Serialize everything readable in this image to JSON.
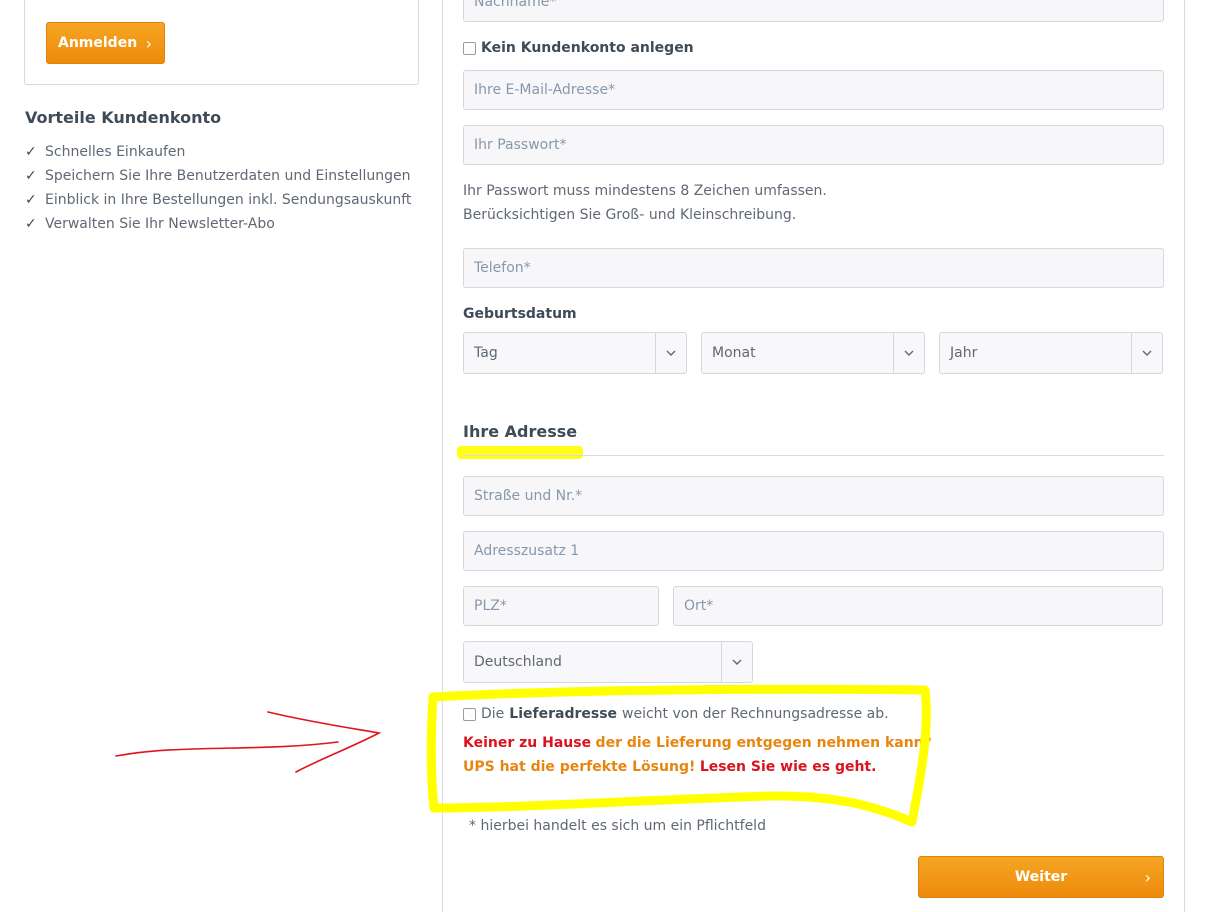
{
  "left": {
    "login_button": "Anmelden",
    "advantages_title": "Vorteile Kundenkonto",
    "advantages": [
      "Schnelles Einkaufen",
      "Speichern Sie Ihre Benutzerdaten und Einstellungen",
      "Einblick in Ihre Bestellungen inkl. Sendungsauskunft",
      "Verwalten Sie Ihr Newsletter-Abo"
    ]
  },
  "form": {
    "lastname_placeholder": "Nachname*",
    "no_account_label": "Kein Kundenkonto anlegen",
    "email_placeholder": "Ihre E-Mail-Adresse*",
    "password_placeholder": "Ihr Passwort*",
    "password_hint_1": "Ihr Passwort muss mindestens 8 Zeichen umfassen.",
    "password_hint_2": "Berücksichtigen Sie Groß- und Kleinschreibung.",
    "phone_placeholder": "Telefon*",
    "birthdate_label": "Geburtsdatum",
    "day_select": "Tag",
    "month_select": "Monat",
    "year_select": "Jahr"
  },
  "address": {
    "title": "Ihre Adresse",
    "street_placeholder": "Straße und Nr.*",
    "addition_placeholder": "Adresszusatz 1",
    "zip_placeholder": "PLZ*",
    "city_placeholder": "Ort*",
    "country_select": "Deutschland",
    "delivery_prefix": "Die",
    "delivery_bold": "Lieferadresse",
    "delivery_suffix": "weicht von der Rechnungsadresse ab.",
    "promo_red_1": "Keiner zu Hause",
    "promo_orange_1": "der die Lieferung entgegen nehmen kann?",
    "promo_orange_2": "UPS hat die perfekte Lösung!",
    "promo_red_2": "Lesen Sie wie es geht",
    "promo_end": ".",
    "required_note": "* hierbei handelt es sich um ein Pflichtfeld",
    "next_button": "Weiter"
  },
  "colors": {
    "accent_orange": "#ee8a0b",
    "promo_red": "#d9141e",
    "promo_orange": "#e8850f",
    "highlight_yellow": "#ffff00",
    "arrow_red": "#e0141e"
  }
}
